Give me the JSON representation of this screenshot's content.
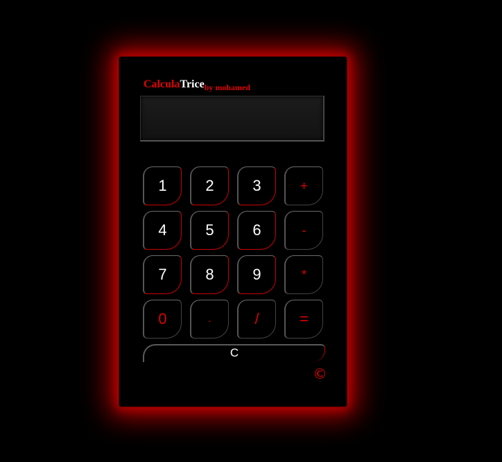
{
  "app": {
    "title_part1": "Calcula",
    "title_part2": "Trice",
    "title_by": "by mohamed",
    "copyright": "©"
  },
  "display": {
    "value": ""
  },
  "keys": {
    "k1": "1",
    "k2": "2",
    "k3": "3",
    "plus": "+",
    "k4": "4",
    "k5": "5",
    "k6": "6",
    "minus": "-",
    "k7": "7",
    "k8": "8",
    "k9": "9",
    "multiply": "*",
    "k0": "0",
    "dot": ".",
    "divide": "/",
    "equals": "=",
    "clear": "C"
  },
  "colors": {
    "accent": "#e00000",
    "glow": "#c80000",
    "background": "#000000",
    "text": "#ffffff"
  }
}
